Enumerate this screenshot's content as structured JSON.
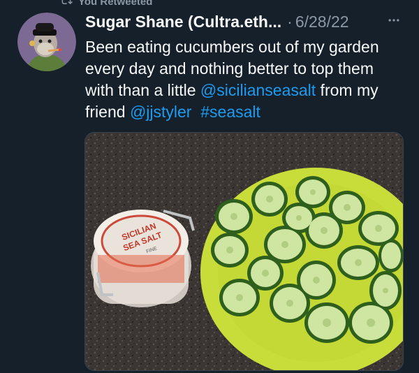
{
  "retweet": {
    "label": "You Retweeted",
    "icon": "retweet-icon"
  },
  "tweet": {
    "author_name": "Sugar Shane (Cultra.eth...",
    "separator": "·",
    "date": "6/28/22",
    "text": {
      "part1": "Been eating cucumbers out of my garden every day and nothing better to top them with than a little ",
      "mention1": "@sicilianseasalt",
      "part2": " from my friend ",
      "mention2": "@jjstyler",
      "part3": "  ",
      "hashtag": "#seasalt"
    },
    "media_jar_label": {
      "line1": "SICILIAN",
      "line2": "SEA SALT",
      "line3": "FINE"
    }
  },
  "colors": {
    "background": "#15202b",
    "link": "#1d9bf0",
    "secondary_text": "#8b98a5",
    "plate": "#c9dd3a",
    "cucumber_skin": "#2f5f1c",
    "cucumber_flesh": "#cfe6a3"
  }
}
